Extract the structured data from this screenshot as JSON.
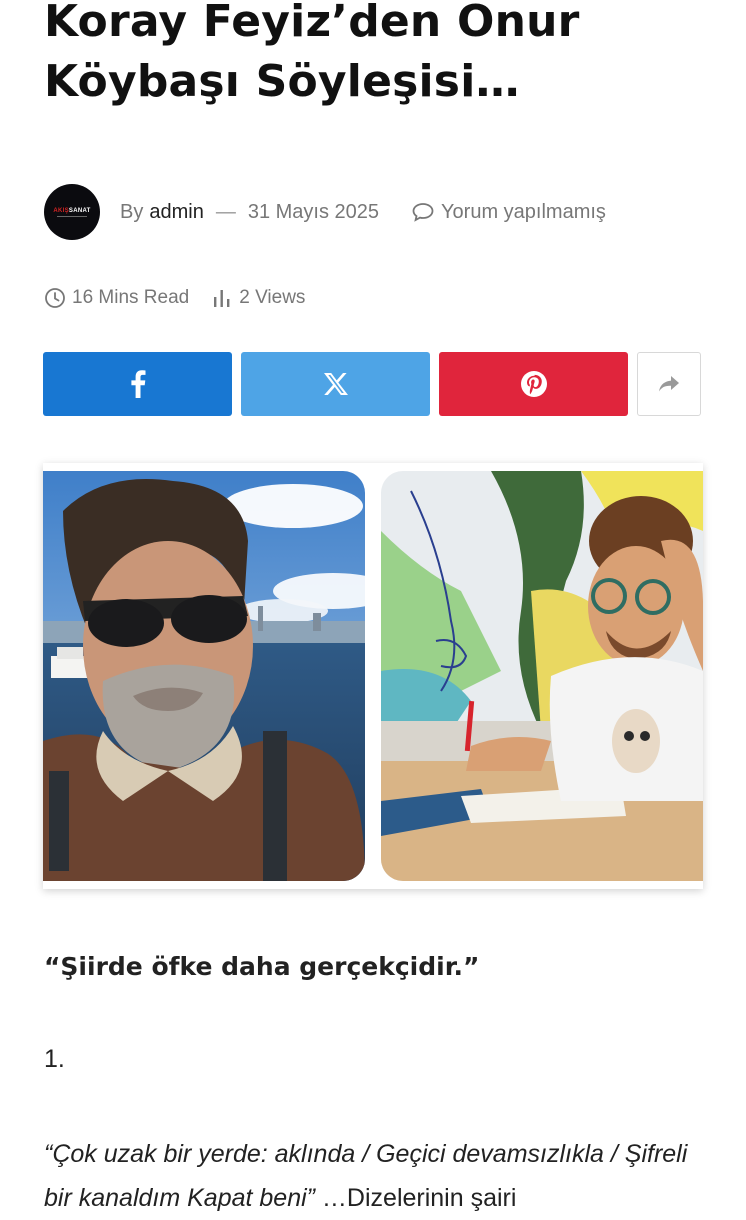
{
  "article": {
    "title": "Koray  Feyiz’den  Onur Köybaşı Söyleşisi…",
    "meta": {
      "by_label": "By",
      "author": "admin",
      "separator": "—",
      "date": "31 Mayıs 2025",
      "comments": "Yorum yapılmamış",
      "read_time": "16 Mins Read",
      "views": "2 Views"
    },
    "avatar": {
      "brand_red": "AKIŞ",
      "brand_white": "SANAT"
    },
    "share": {
      "facebook_color": "#1877d2",
      "twitter_color": "#4ea4e6",
      "pinterest_color": "#e0253c"
    },
    "body": {
      "quote": "“Şiirde öfke daha gerçekçidir.”",
      "section_number": "1.",
      "para_italic": "“Çok uzak bir yerde: aklında / Geçici devamsızlıkla / Şifreli bir kanaldım Kapat beni”",
      "para_rest": " …Dizelerinin şairi"
    }
  }
}
